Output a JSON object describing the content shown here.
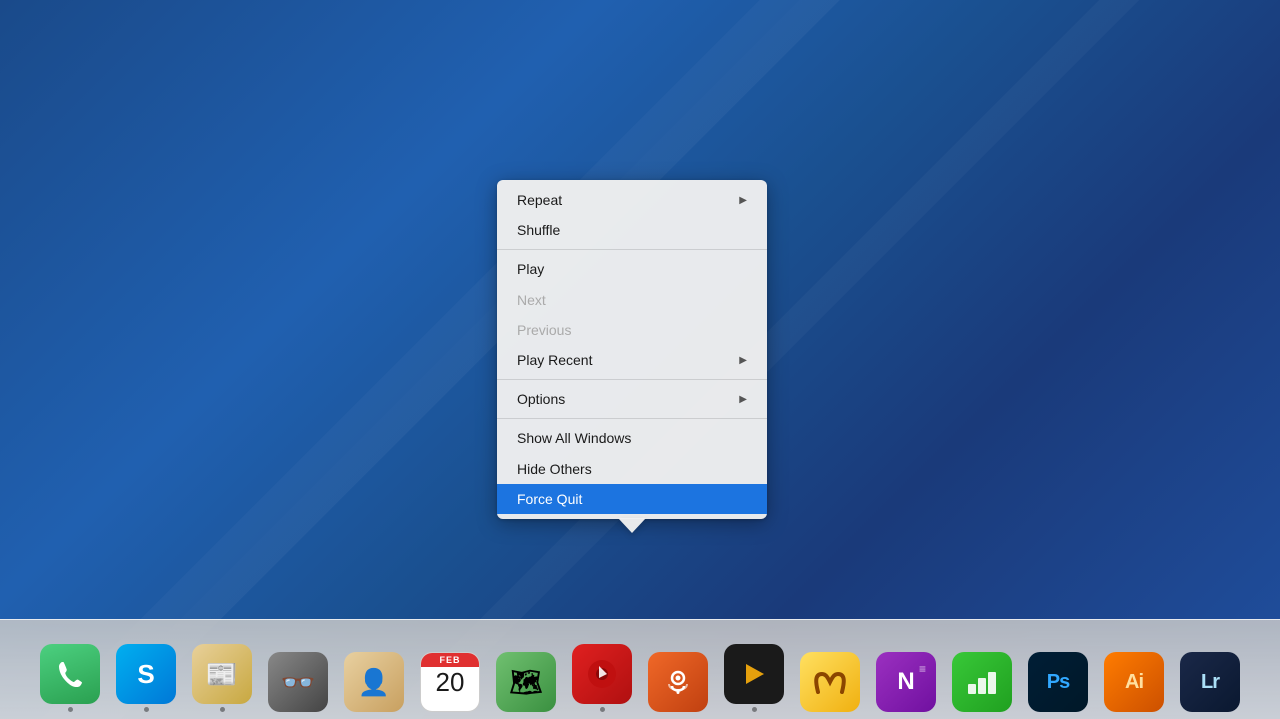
{
  "desktop": {
    "background_color": "#1a4a8a"
  },
  "context_menu": {
    "items": [
      {
        "id": "repeat",
        "label": "Repeat",
        "has_arrow": true,
        "disabled": false,
        "highlighted": false,
        "separator_after": false
      },
      {
        "id": "shuffle",
        "label": "Shuffle",
        "has_arrow": false,
        "disabled": false,
        "highlighted": false,
        "separator_after": true
      },
      {
        "id": "play",
        "label": "Play",
        "has_arrow": false,
        "disabled": false,
        "highlighted": false,
        "separator_after": false
      },
      {
        "id": "next",
        "label": "Next",
        "has_arrow": false,
        "disabled": true,
        "highlighted": false,
        "separator_after": false
      },
      {
        "id": "previous",
        "label": "Previous",
        "has_arrow": false,
        "disabled": true,
        "highlighted": false,
        "separator_after": false
      },
      {
        "id": "play-recent",
        "label": "Play Recent",
        "has_arrow": true,
        "disabled": false,
        "highlighted": false,
        "separator_after": true
      },
      {
        "id": "options",
        "label": "Options",
        "has_arrow": true,
        "disabled": false,
        "highlighted": false,
        "separator_after": true
      },
      {
        "id": "show-all-windows",
        "label": "Show All Windows",
        "has_arrow": false,
        "disabled": false,
        "highlighted": false,
        "separator_after": false
      },
      {
        "id": "hide-others",
        "label": "Hide Others",
        "has_arrow": false,
        "disabled": false,
        "highlighted": false,
        "separator_after": false
      },
      {
        "id": "force-quit",
        "label": "Force Quit",
        "has_arrow": false,
        "disabled": false,
        "highlighted": true,
        "separator_after": false
      }
    ]
  },
  "dock": {
    "items": [
      {
        "id": "phone",
        "label": "Phone",
        "class": "app-phone",
        "text": "📞",
        "dot": true
      },
      {
        "id": "skype",
        "label": "Skype",
        "class": "app-skype",
        "text": "S",
        "dot": true
      },
      {
        "id": "readkit",
        "label": "ReadKit",
        "class": "app-readkit",
        "text": "📰",
        "dot": true
      },
      {
        "id": "references",
        "label": "References",
        "class": "app-references",
        "text": "👓",
        "dot": false
      },
      {
        "id": "contacts",
        "label": "Contacts",
        "class": "app-contacts",
        "text": "👤",
        "dot": false
      },
      {
        "id": "calendar",
        "label": "Calendar",
        "class": "app-calendar",
        "text": "20",
        "dot": false,
        "is_calendar": true
      },
      {
        "id": "maps",
        "label": "Maps",
        "class": "app-maps",
        "text": "🗺",
        "dot": false
      },
      {
        "id": "music",
        "label": "Music",
        "class": "app-music",
        "text": "♪",
        "dot": true
      },
      {
        "id": "podcasts",
        "label": "Podcasts",
        "class": "app-podcasts",
        "text": "🎙",
        "dot": false
      },
      {
        "id": "plex",
        "label": "Plex",
        "class": "app-plex",
        "text": "▶",
        "dot": true
      },
      {
        "id": "horns",
        "label": "Horns",
        "class": "app-horns",
        "text": "🐂",
        "dot": false
      },
      {
        "id": "onenote",
        "label": "OneNote",
        "class": "app-onenote",
        "text": "N",
        "dot": false
      },
      {
        "id": "numbers",
        "label": "Numbers",
        "class": "app-numbers",
        "text": "📊",
        "dot": false
      },
      {
        "id": "photoshop",
        "label": "Photoshop",
        "class": "app-photoshop",
        "text": "Ps",
        "dot": false
      },
      {
        "id": "illustrator",
        "label": "Illustrator",
        "class": "app-illustrator",
        "text": "Ai",
        "dot": false
      },
      {
        "id": "lightroom",
        "label": "Lightroom",
        "class": "app-lightroom",
        "text": "Lr",
        "dot": false
      }
    ]
  }
}
